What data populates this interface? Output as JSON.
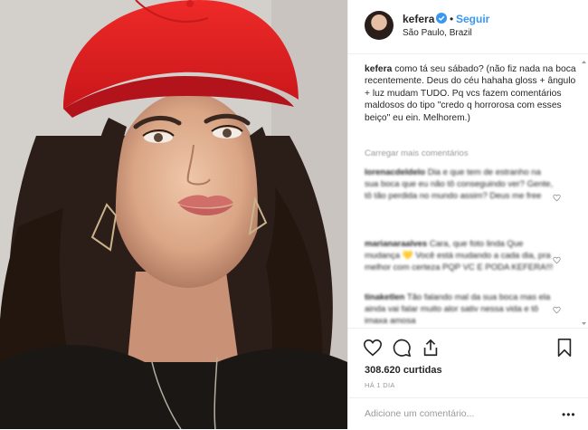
{
  "post": {
    "photo": {
      "subject": "woman-red-cap-portrait",
      "cap_color": "#e1201f"
    },
    "header": {
      "username": "kefera",
      "separator": "•",
      "follow_label": "Seguir",
      "location": "São Paulo, Brazil",
      "verified_icon": "verified-badge-icon",
      "accent_color": "#3897f0"
    },
    "caption": {
      "username": "kefera",
      "text": "como tá seu sábado? (não fiz nada na boca recentemente. Deus do céu hahaha gloss + ângulo + luz mudam TUDO. Pq vcs fazem comentários maldosos do tipo \"credo q horrorosa com esses beiço\" eu ein. Melhorem.)"
    },
    "load_more_label": "Carregar mais comentários",
    "comments": [
      {
        "user": "lorenacdeldelo",
        "text": "Dia e que tem de estranho na sua boca que eu não tô conseguindo ver? Gente, tô tão perdida no mundo assim? Deus me free"
      },
      {
        "user": "marianaraalves",
        "text": "Cara, que foto linda Que mudança 💛 Você está mudando a cada dia, pra melhor com certeza PQP VC E PODA KEFERA!!!"
      },
      {
        "user": "tinaketlen",
        "text": "Tão falando mal da sua boca mas ela ainda vai falar muito alor sativ nessa vida e tô imaxa amosa"
      }
    ],
    "actions": {
      "like_icon": "heart-icon",
      "comment_icon": "comment-bubble-icon",
      "share_icon": "share-icon",
      "save_icon": "bookmark-icon"
    },
    "likes_text": "308.620 curtidas",
    "timestamp": "HÁ 1 DIA",
    "add_comment_placeholder": "Adicione um comentário...",
    "more_options": "•••"
  }
}
